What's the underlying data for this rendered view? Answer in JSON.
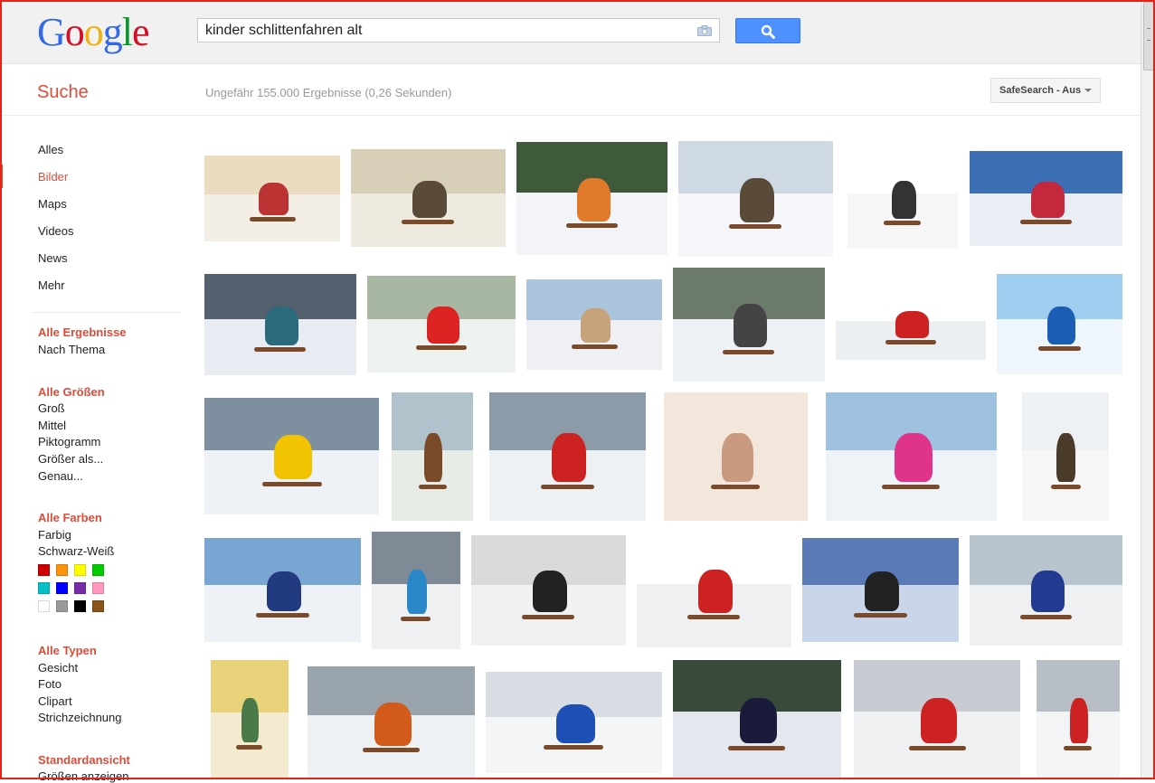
{
  "header": {
    "logo_letters": [
      {
        "char": "G",
        "color": "#3369e8"
      },
      {
        "char": "o",
        "color": "#d50f25"
      },
      {
        "char": "o",
        "color": "#eeb211"
      },
      {
        "char": "g",
        "color": "#3369e8"
      },
      {
        "char": "l",
        "color": "#009925"
      },
      {
        "char": "e",
        "color": "#d50f25"
      }
    ],
    "search_query": "kinder schlittenfahren alt",
    "search_button_icon": "magnifier-icon",
    "camera_icon": "camera-icon"
  },
  "subbar": {
    "title": "Suche",
    "result_stats": "Ungefähr 155.000 Ergebnisse (0,26 Sekunden)",
    "safesearch_label": "SafeSearch - Aus"
  },
  "nav": {
    "items": [
      {
        "label": "Alles",
        "active": false
      },
      {
        "label": "Bilder",
        "active": true
      },
      {
        "label": "Maps",
        "active": false
      },
      {
        "label": "Videos",
        "active": false
      },
      {
        "label": "News",
        "active": false
      },
      {
        "label": "Mehr",
        "active": false
      }
    ]
  },
  "filters": {
    "results": {
      "heading": "Alle Ergebnisse",
      "links": [
        "Nach Thema"
      ]
    },
    "sizes": {
      "heading": "Alle Größen",
      "links": [
        "Groß",
        "Mittel",
        "Piktogramm",
        "Größer als...",
        "Genau..."
      ]
    },
    "colors": {
      "heading": "Alle Farben",
      "links": [
        "Farbig",
        "Schwarz-Weiß"
      ],
      "swatches": [
        "#cc0000",
        "#fb940b",
        "#ffff00",
        "#00cc00",
        "#03c0c6",
        "#0000ff",
        "#762ca7",
        "#ff98bf",
        "#ffffff",
        "#999999",
        "#000000",
        "#885418"
      ]
    },
    "types": {
      "heading": "Alle Typen",
      "links": [
        "Gesicht",
        "Foto",
        "Clipart",
        "Strichzeichnung"
      ]
    },
    "view": {
      "heading": "Standardansicht",
      "links": [
        "Größen anzeigen"
      ]
    }
  },
  "results": {
    "count": 29
  }
}
